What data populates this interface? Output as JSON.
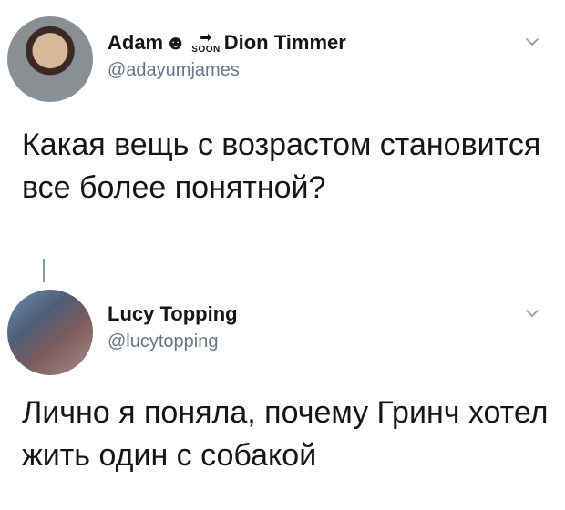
{
  "tweets": [
    {
      "name_part1": "Adam",
      "name_emoji": "☻",
      "soon_arrow": "➡",
      "soon_label": "SOON",
      "name_part2": "Dion Timmer",
      "handle": "@adayumjames",
      "text": "Какая вещь с возрастом становится все более понятной?",
      "menu_icon": "chevron-down-icon"
    },
    {
      "name": "Lucy Topping",
      "handle": "@lucytopping",
      "text": "Лично я поняла, почему Гринч хотел жить один с собакой",
      "menu_icon": "chevron-down-icon"
    }
  ],
  "colors": {
    "text": "#14171a",
    "secondary": "#657786",
    "thread_line": "#8899a6",
    "background": "#ffffff"
  }
}
